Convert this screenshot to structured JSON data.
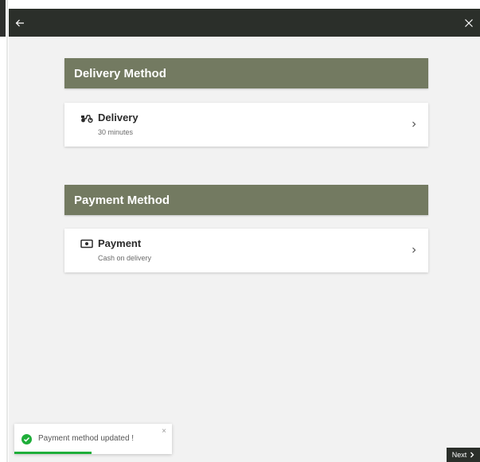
{
  "topbar": {
    "back_icon": "arrow-left-icon",
    "close_icon": "close-icon"
  },
  "delivery_section": {
    "header": "Delivery Method",
    "card": {
      "icon": "scooter-icon",
      "title": "Delivery",
      "subtitle": "30 minutes"
    }
  },
  "payment_section": {
    "header": "Payment Method",
    "card": {
      "icon": "cash-icon",
      "title": "Payment",
      "subtitle": "Cash on delivery"
    }
  },
  "toast": {
    "message": "Payment method updated !",
    "close": "×",
    "progress_fraction": 0.49,
    "color": "#1fae3a"
  },
  "footer": {
    "next_label": "Next"
  },
  "colors": {
    "topbar": "#2b2f2a",
    "section_header": "#737a61",
    "background": "#f2f2f2"
  }
}
